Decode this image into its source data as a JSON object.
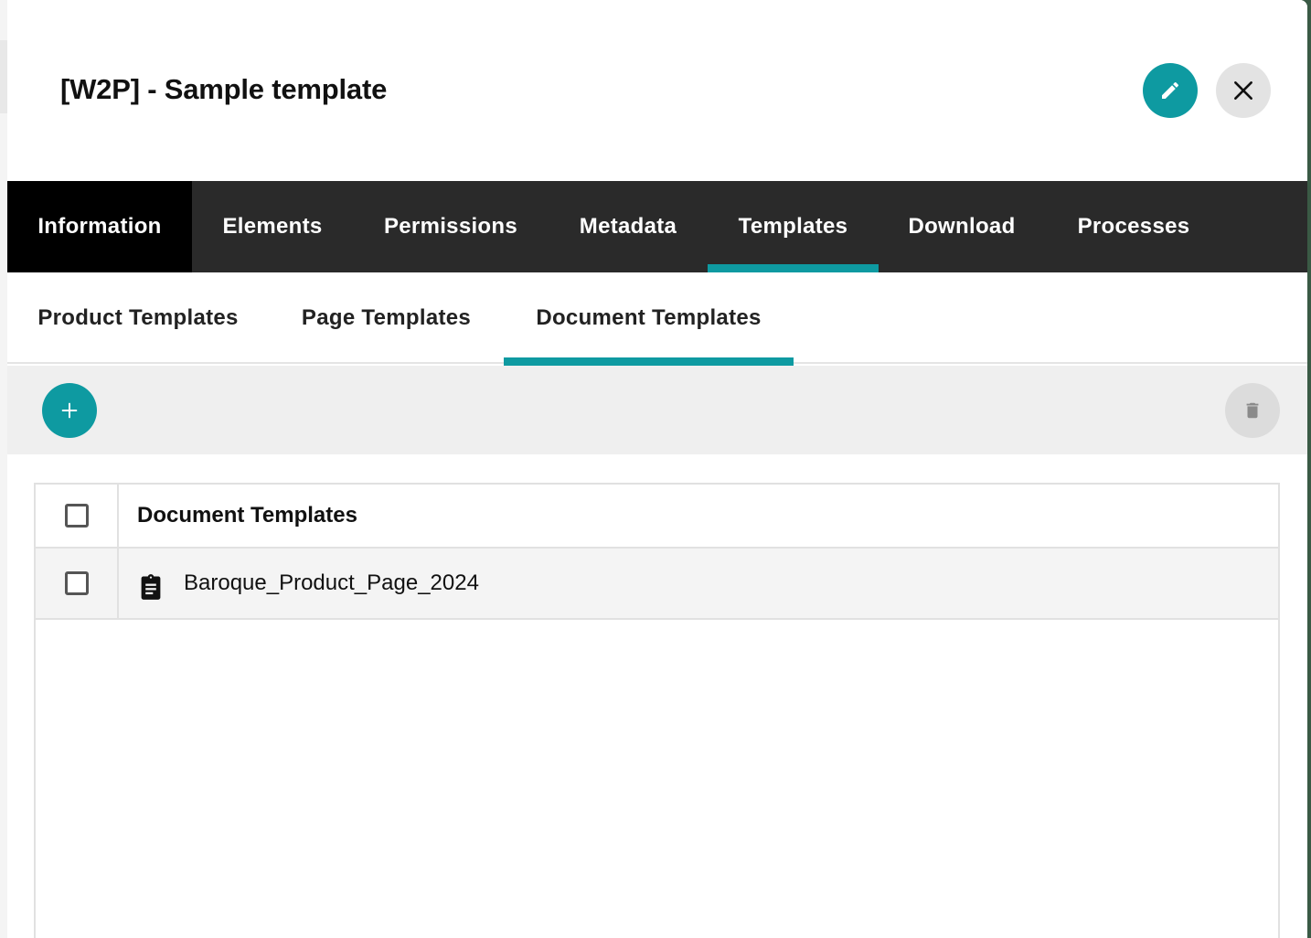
{
  "header": {
    "title": "[W2P] - Sample template",
    "edit_icon": "pencil-icon",
    "close_icon": "close-icon"
  },
  "main_tabs": [
    {
      "label": "Information"
    },
    {
      "label": "Elements"
    },
    {
      "label": "Permissions"
    },
    {
      "label": "Metadata"
    },
    {
      "label": "Templates",
      "active": true
    },
    {
      "label": "Download"
    },
    {
      "label": "Processes"
    }
  ],
  "sub_tabs": [
    {
      "label": "Product Templates"
    },
    {
      "label": "Page Templates"
    },
    {
      "label": "Document Templates",
      "active": true
    }
  ],
  "toolbar": {
    "add_icon": "plus-icon",
    "delete_icon": "trash-icon"
  },
  "table": {
    "header": "Document Templates",
    "rows": [
      {
        "name": "Baroque_Product_Page_2024",
        "icon": "clipboard-document-icon",
        "checked": false
      }
    ]
  },
  "colors": {
    "accent": "#0e9aa1",
    "tab_bar": "#2a2a2a",
    "active_main_tab_bg": "#000000"
  }
}
